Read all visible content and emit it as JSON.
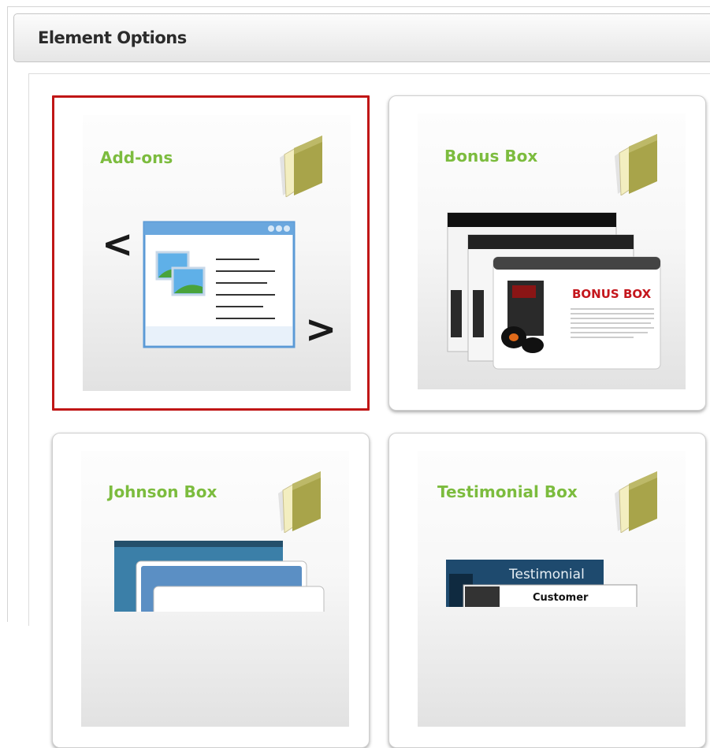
{
  "header": {
    "title": "Element Options"
  },
  "cards": [
    {
      "title": "Add-ons",
      "selected": true
    },
    {
      "title": "Bonus Box",
      "selected": false,
      "preview_heading": "BONUS BOX"
    },
    {
      "title": "Johnson Box",
      "selected": false
    },
    {
      "title": "Testimonial Box",
      "selected": false,
      "preview_heading": "Testimonial",
      "preview_subheading": "Customer"
    }
  ],
  "colors": {
    "title_green": "#7cbc3e",
    "selected_border": "#c01616",
    "folder": "#a7a54b"
  },
  "icons": [
    "folder-icon",
    "chevron-left-icon",
    "chevron-right-icon",
    "window-icon",
    "image-icon"
  ]
}
